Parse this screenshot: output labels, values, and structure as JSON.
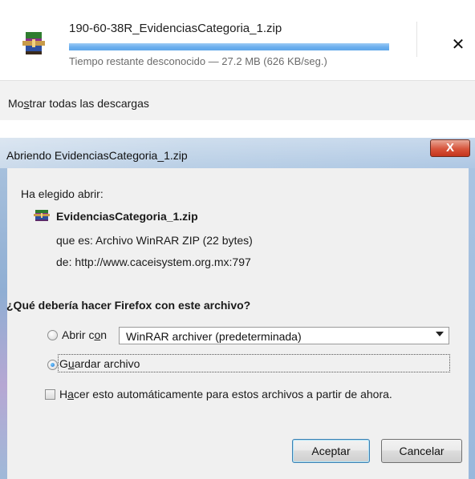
{
  "downloads": {
    "item": {
      "filename": "190-60-38R_EvidenciasCategoria_1.zip",
      "progress_fraction": 1.0,
      "status": "Tiempo restante desconocido — 27.2 MB (626 KB/seg.)",
      "close_glyph": "✕",
      "icon": "winrar-archive-icon"
    },
    "show_all_prefix": "Mo",
    "show_all_accel": "s",
    "show_all_suffix": "trar todas las descargas"
  },
  "dialog": {
    "title": "Abriendo EvidenciasCategoria_1.zip",
    "close_glyph": "X",
    "intro": "Ha elegido abrir:",
    "filename": "EvidenciasCategoria_1.zip",
    "type_line": "que es: Archivo WinRAR ZIP (22 bytes)",
    "from_line": "de: http://www.caceisystem.org.mx:797",
    "question": "¿Qué debería hacer Firefox con este archivo?",
    "open_with": {
      "prefix": "Abrir c",
      "accel": "o",
      "suffix": "n",
      "selected": false
    },
    "app_select": "WinRAR archiver (predeterminada)",
    "save_file": {
      "prefix": "G",
      "accel": "u",
      "suffix": "ardar archivo",
      "selected": true
    },
    "auto": {
      "prefix": "H",
      "accel": "a",
      "suffix": "cer esto automáticamente para estos archivos a partir de ahora.",
      "checked": false
    },
    "ok_label": "Aceptar",
    "cancel_label": "Cancelar"
  },
  "colors": {
    "titlebar": "#b5cce4",
    "progress": "#6aaeee",
    "close_red": "#d7543b",
    "dialog_bg": "#f0f0f0"
  }
}
